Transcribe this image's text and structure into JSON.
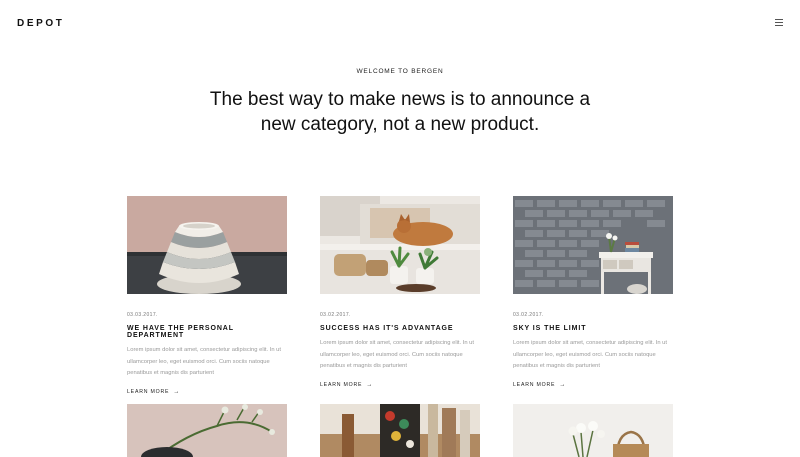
{
  "brand": {
    "logo": "DEPOT"
  },
  "nav": {
    "menu_icon": "hamburger-menu-icon"
  },
  "intro": {
    "eyebrow": "WELCOME TO BERGEN",
    "headline_line1": "The best way to make news is to announce a",
    "headline_line2": "new category, not a new product."
  },
  "posts": [
    {
      "date": "03.03.2017.",
      "title": "WE HAVE THE PERSONAL DEPARTMENT",
      "excerpt": "Lorem ipsum dolor sit amet, consectetur adipiscing elit. In ut ullamcorper leo, eget euismod orci. Cum sociis natoque penatibus et magnis dis parturient",
      "more": "LEARN MORE",
      "image": "stacked-ceramic-bowls"
    },
    {
      "date": "03.02.2017.",
      "title": "SUCCESS HAS IT'S ADVANTAGE",
      "excerpt": "Lorem ipsum dolor sit amet, consectetur adipiscing elit. In ut ullamcorper leo, eget euismod orci. Cum sociis natoque penatibus et magnis dis parturient",
      "more": "LEARN MORE",
      "image": "cat-on-sofa-with-plants"
    },
    {
      "date": "03.02.2017.",
      "title": "SKY IS THE LIMIT",
      "excerpt": "Lorem ipsum dolor sit amet, consectetur adipiscing elit. In ut ullamcorper leo, eget euismod orci. Cum sociis natoque penatibus et magnis dis parturient",
      "more": "LEARN MORE",
      "image": "brick-wall-side-table"
    }
  ],
  "more_posts": [
    {
      "image": "flower-branch-vase"
    },
    {
      "image": "books-and-objects"
    },
    {
      "image": "white-flowers-basket"
    }
  ],
  "colors": {
    "text": "#111111",
    "muted": "#9a9a9a",
    "background": "#ffffff"
  }
}
